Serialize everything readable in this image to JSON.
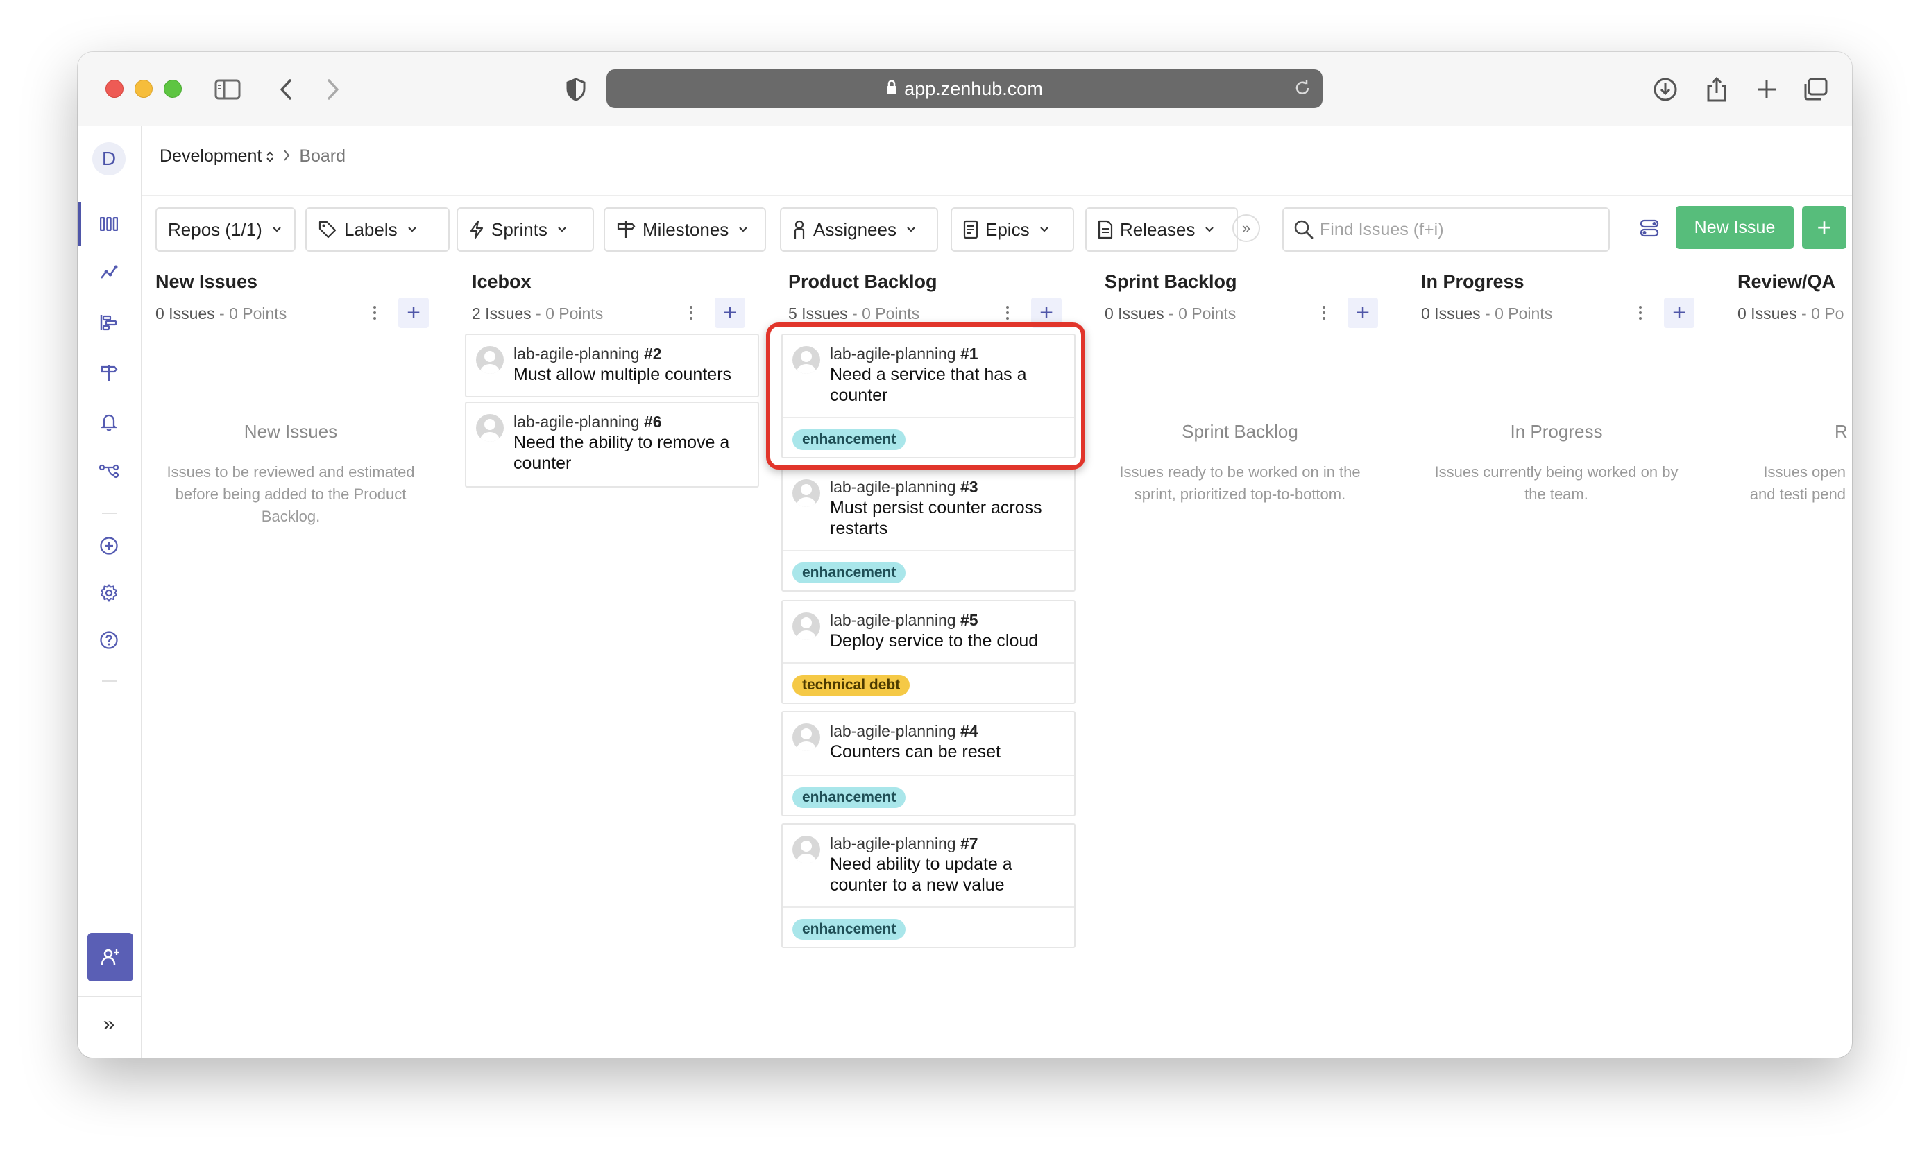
{
  "browser": {
    "url": "app.zenhub.com"
  },
  "sidebar": {
    "workspace_initial": "D",
    "expand_label": "»"
  },
  "breadcrumb": {
    "workspace": "Development",
    "page": "Board"
  },
  "toolbar": {
    "filters": [
      "Repos (1/1)",
      "Labels",
      "Sprints",
      "Milestones",
      "Assignees",
      "Epics",
      "Releases"
    ],
    "more_label": "»",
    "search_placeholder": "Find Issues (f+i)",
    "new_issue_label": "New Issue",
    "add_label": "+"
  },
  "colors": {
    "accent": "#4f56a8",
    "primary_button": "#57bd7b",
    "enhancement_badge": "#a9e6ea",
    "debt_badge": "#f5c946",
    "highlight": "#e1352b"
  },
  "columns": [
    {
      "title": "New Issues",
      "count": "0 Issues",
      "points": " - 0 Points",
      "empty_title": "New Issues",
      "empty_desc": "Issues to be reviewed and estimated before being added to the Product Backlog."
    },
    {
      "title": "Icebox",
      "count": "2 Issues",
      "points": " - 0 Points",
      "cards": [
        {
          "repo": "lab-agile-planning",
          "number": "#2",
          "title": "Must allow multiple counters"
        },
        {
          "repo": "lab-agile-planning",
          "number": "#6",
          "title": "Need the ability to remove a counter"
        }
      ]
    },
    {
      "title": "Product Backlog",
      "count": "5 Issues",
      "points": " - 0 Points",
      "cards": [
        {
          "repo": "lab-agile-planning",
          "number": "#1",
          "title": "Need a service that has a counter",
          "label": "enhancement"
        },
        {
          "repo": "lab-agile-planning",
          "number": "#3",
          "title": "Must persist counter across restarts",
          "label": "enhancement"
        },
        {
          "repo": "lab-agile-planning",
          "number": "#5",
          "title": "Deploy service to the cloud",
          "label": "technical debt"
        },
        {
          "repo": "lab-agile-planning",
          "number": "#4",
          "title": "Counters can be reset",
          "label": "enhancement"
        },
        {
          "repo": "lab-agile-planning",
          "number": "#7",
          "title": "Need ability to update a counter to a new value",
          "label": "enhancement"
        }
      ]
    },
    {
      "title": "Sprint Backlog",
      "count": "0 Issues",
      "points": " - 0 Points",
      "empty_title": "Sprint Backlog",
      "empty_desc": "Issues ready to be worked on in the sprint, prioritized top-to-bottom."
    },
    {
      "title": "In Progress",
      "count": "0 Issues",
      "points": " - 0 Points",
      "empty_title": "In Progress",
      "empty_desc": "Issues currently being worked on by the team."
    },
    {
      "title": "Review/QA",
      "count": "0 Issues",
      "points": " - 0 Po",
      "empty_title": "R",
      "empty_desc": "Issues open and testi pend"
    }
  ]
}
